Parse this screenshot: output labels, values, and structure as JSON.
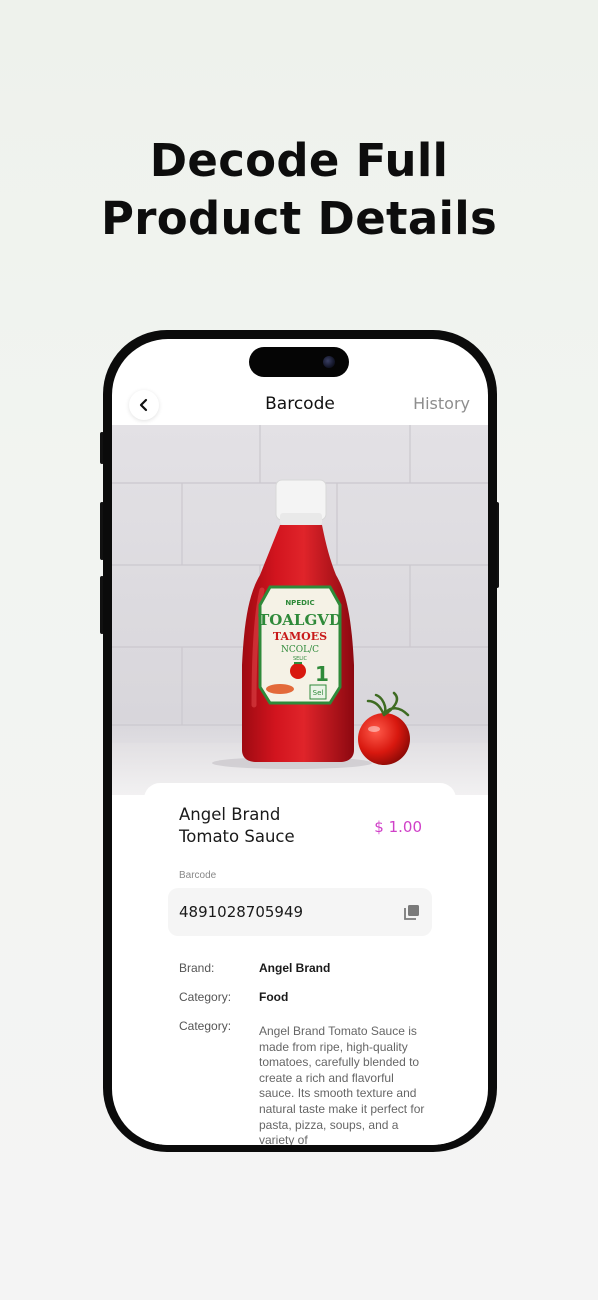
{
  "headline": {
    "line1": "Decode Full",
    "line2": "Product Details"
  },
  "nav": {
    "back_icon": "chevron-left-icon",
    "title": "Barcode",
    "history_label": "History"
  },
  "product": {
    "name_line1": "Angel Brand",
    "name_line2": "Tomato Sauce",
    "price": "$ 1.00",
    "barcode_label": "Barcode",
    "barcode_value": "4891028705949",
    "copy_icon": "copy-icon",
    "details": [
      {
        "label": "Brand:",
        "value": "Angel Brand"
      },
      {
        "label": "Category:",
        "value": "Food"
      },
      {
        "label": "Category:",
        "value": "Angel Brand Tomato Sauce is made from ripe, high-quality tomatoes, carefully blended to create a rich and flavorful sauce. Its smooth texture and natural taste make it perfect for pasta, pizza, soups, and a variety of"
      }
    ]
  },
  "label_art": {
    "l1": "NPEDIC",
    "l2": "TOALGVD",
    "l3": "TAMOES",
    "l4": "NCOL/C",
    "l5": "SELIC",
    "num": "1",
    "small": "Sel"
  },
  "colors": {
    "price": "#d040c8",
    "ketchup": "#c8101a",
    "accent_text": "#8e8e8e"
  }
}
